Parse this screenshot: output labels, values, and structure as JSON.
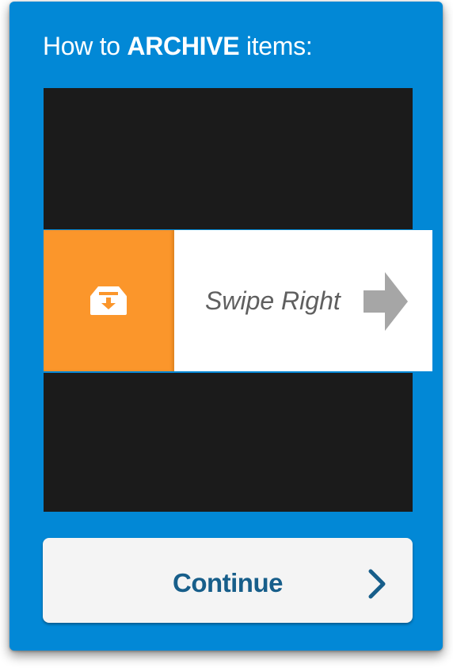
{
  "tutorial": {
    "title_prefix": "How to ",
    "title_action": "ARCHIVE",
    "title_suffix": " items:",
    "swipe_label": "Swipe Right",
    "continue_label": "Continue"
  },
  "icons": {
    "archive": "archive-box-icon",
    "swipe_arrow": "arrow-right-icon",
    "continue_chevron": "chevron-right-icon"
  },
  "colors": {
    "background": "#0288d6",
    "archive_accent": "#fb962b",
    "button_text": "#175e8a",
    "demo_rows": "#1b1b1b"
  }
}
